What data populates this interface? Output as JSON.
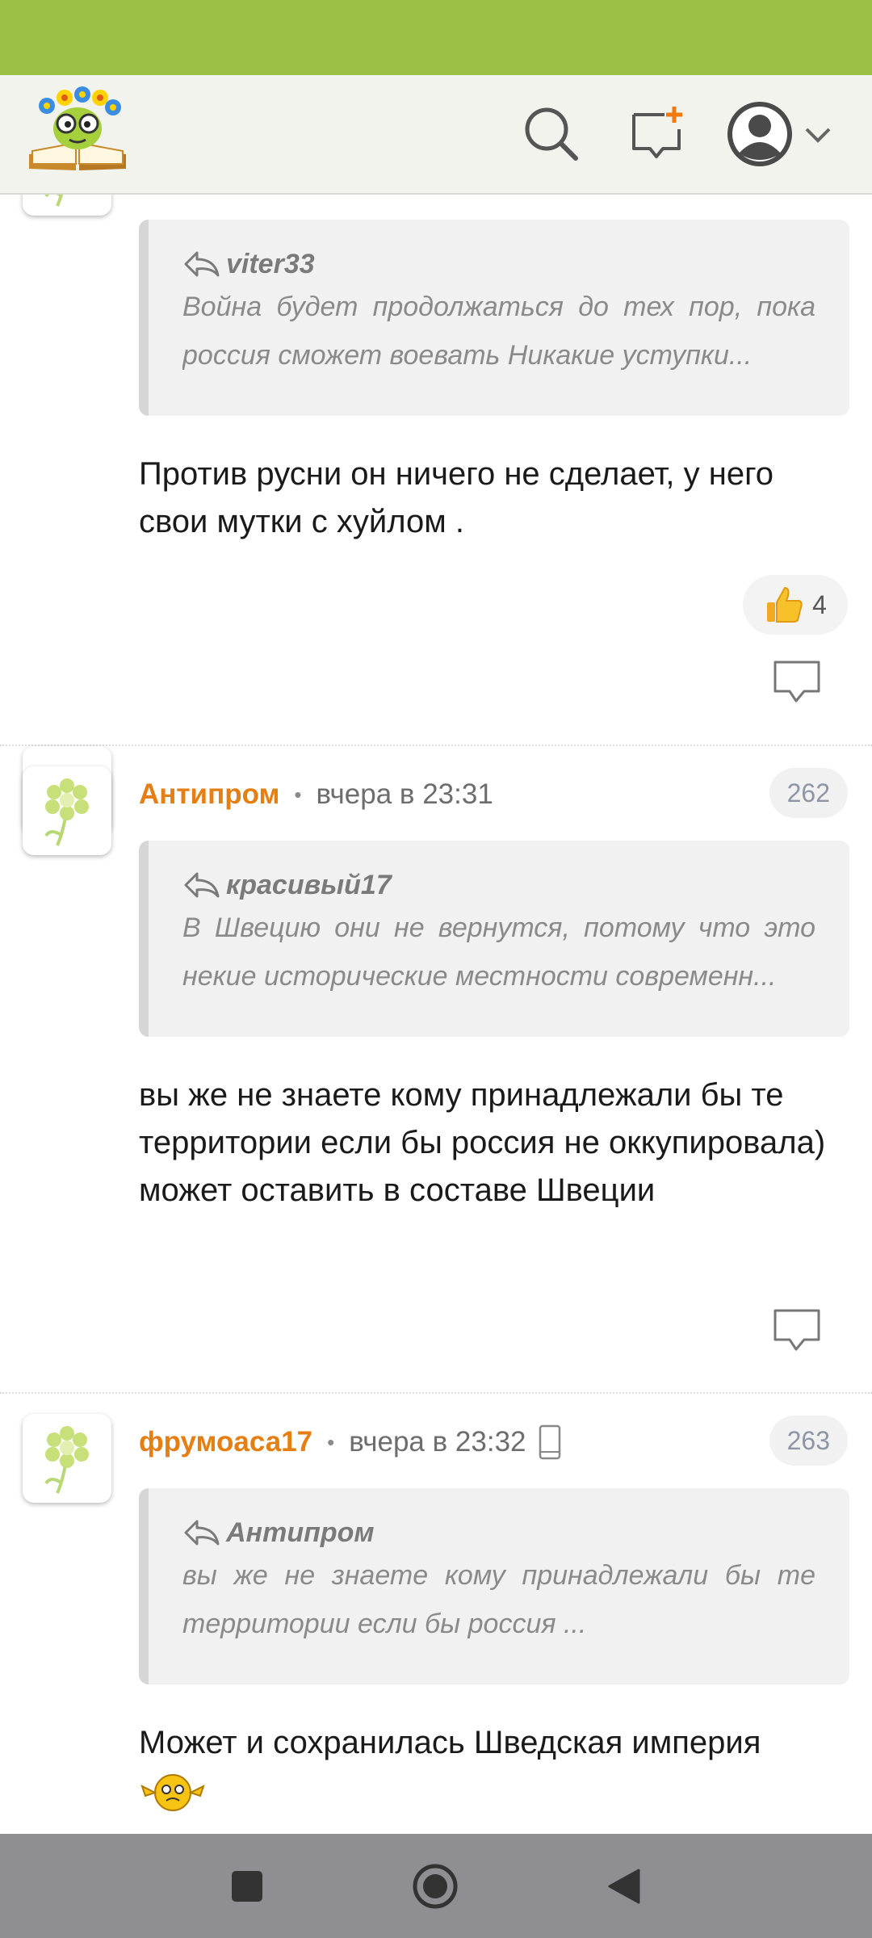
{
  "colors": {
    "status_bar": "#9bc045",
    "author": "#e57e13",
    "nav_bar": "#8f8f93"
  },
  "header": {
    "logo_icon": "bookworm-logo",
    "search_icon": "search-icon",
    "new_post_icon": "new-message-icon",
    "account_icon": "account-icon",
    "account_menu_icon": "chevron-down-icon"
  },
  "comments": [
    {
      "quote_author": "viter33",
      "quote_text": "Война будет продолжаться до тех пор, пока россия сможет воевать Никакие уступки...",
      "text": "Против русни он ничего не сделает, у него свои мутки с хуйлом .",
      "likes": "4"
    },
    {
      "author": "Антипром",
      "time": "вчера в 23:31",
      "number": "262",
      "quote_author": "красивый17",
      "quote_text": "В Швецию они не вернутся, потому что это некие исторические местности современн...",
      "text": "вы же не знаете кому принадлежали бы те территории если бы россия не оккупировала) может оставить в составе Швеции"
    },
    {
      "author": "фрумоаса17",
      "time": "вчера в 23:32",
      "device_icon": "mobile-phone-icon",
      "number": "263",
      "quote_author": "Антипром",
      "quote_text": "вы же не знаете кому принадлежали бы те территории если бы россия ...",
      "text": "Может и сохранилась Шведская империя",
      "emoji_icon": "smiley-emoji-icon"
    }
  ],
  "nav": {
    "recents_icon": "square-icon",
    "home_icon": "home-circle-icon",
    "back_icon": "back-triangle-icon"
  }
}
